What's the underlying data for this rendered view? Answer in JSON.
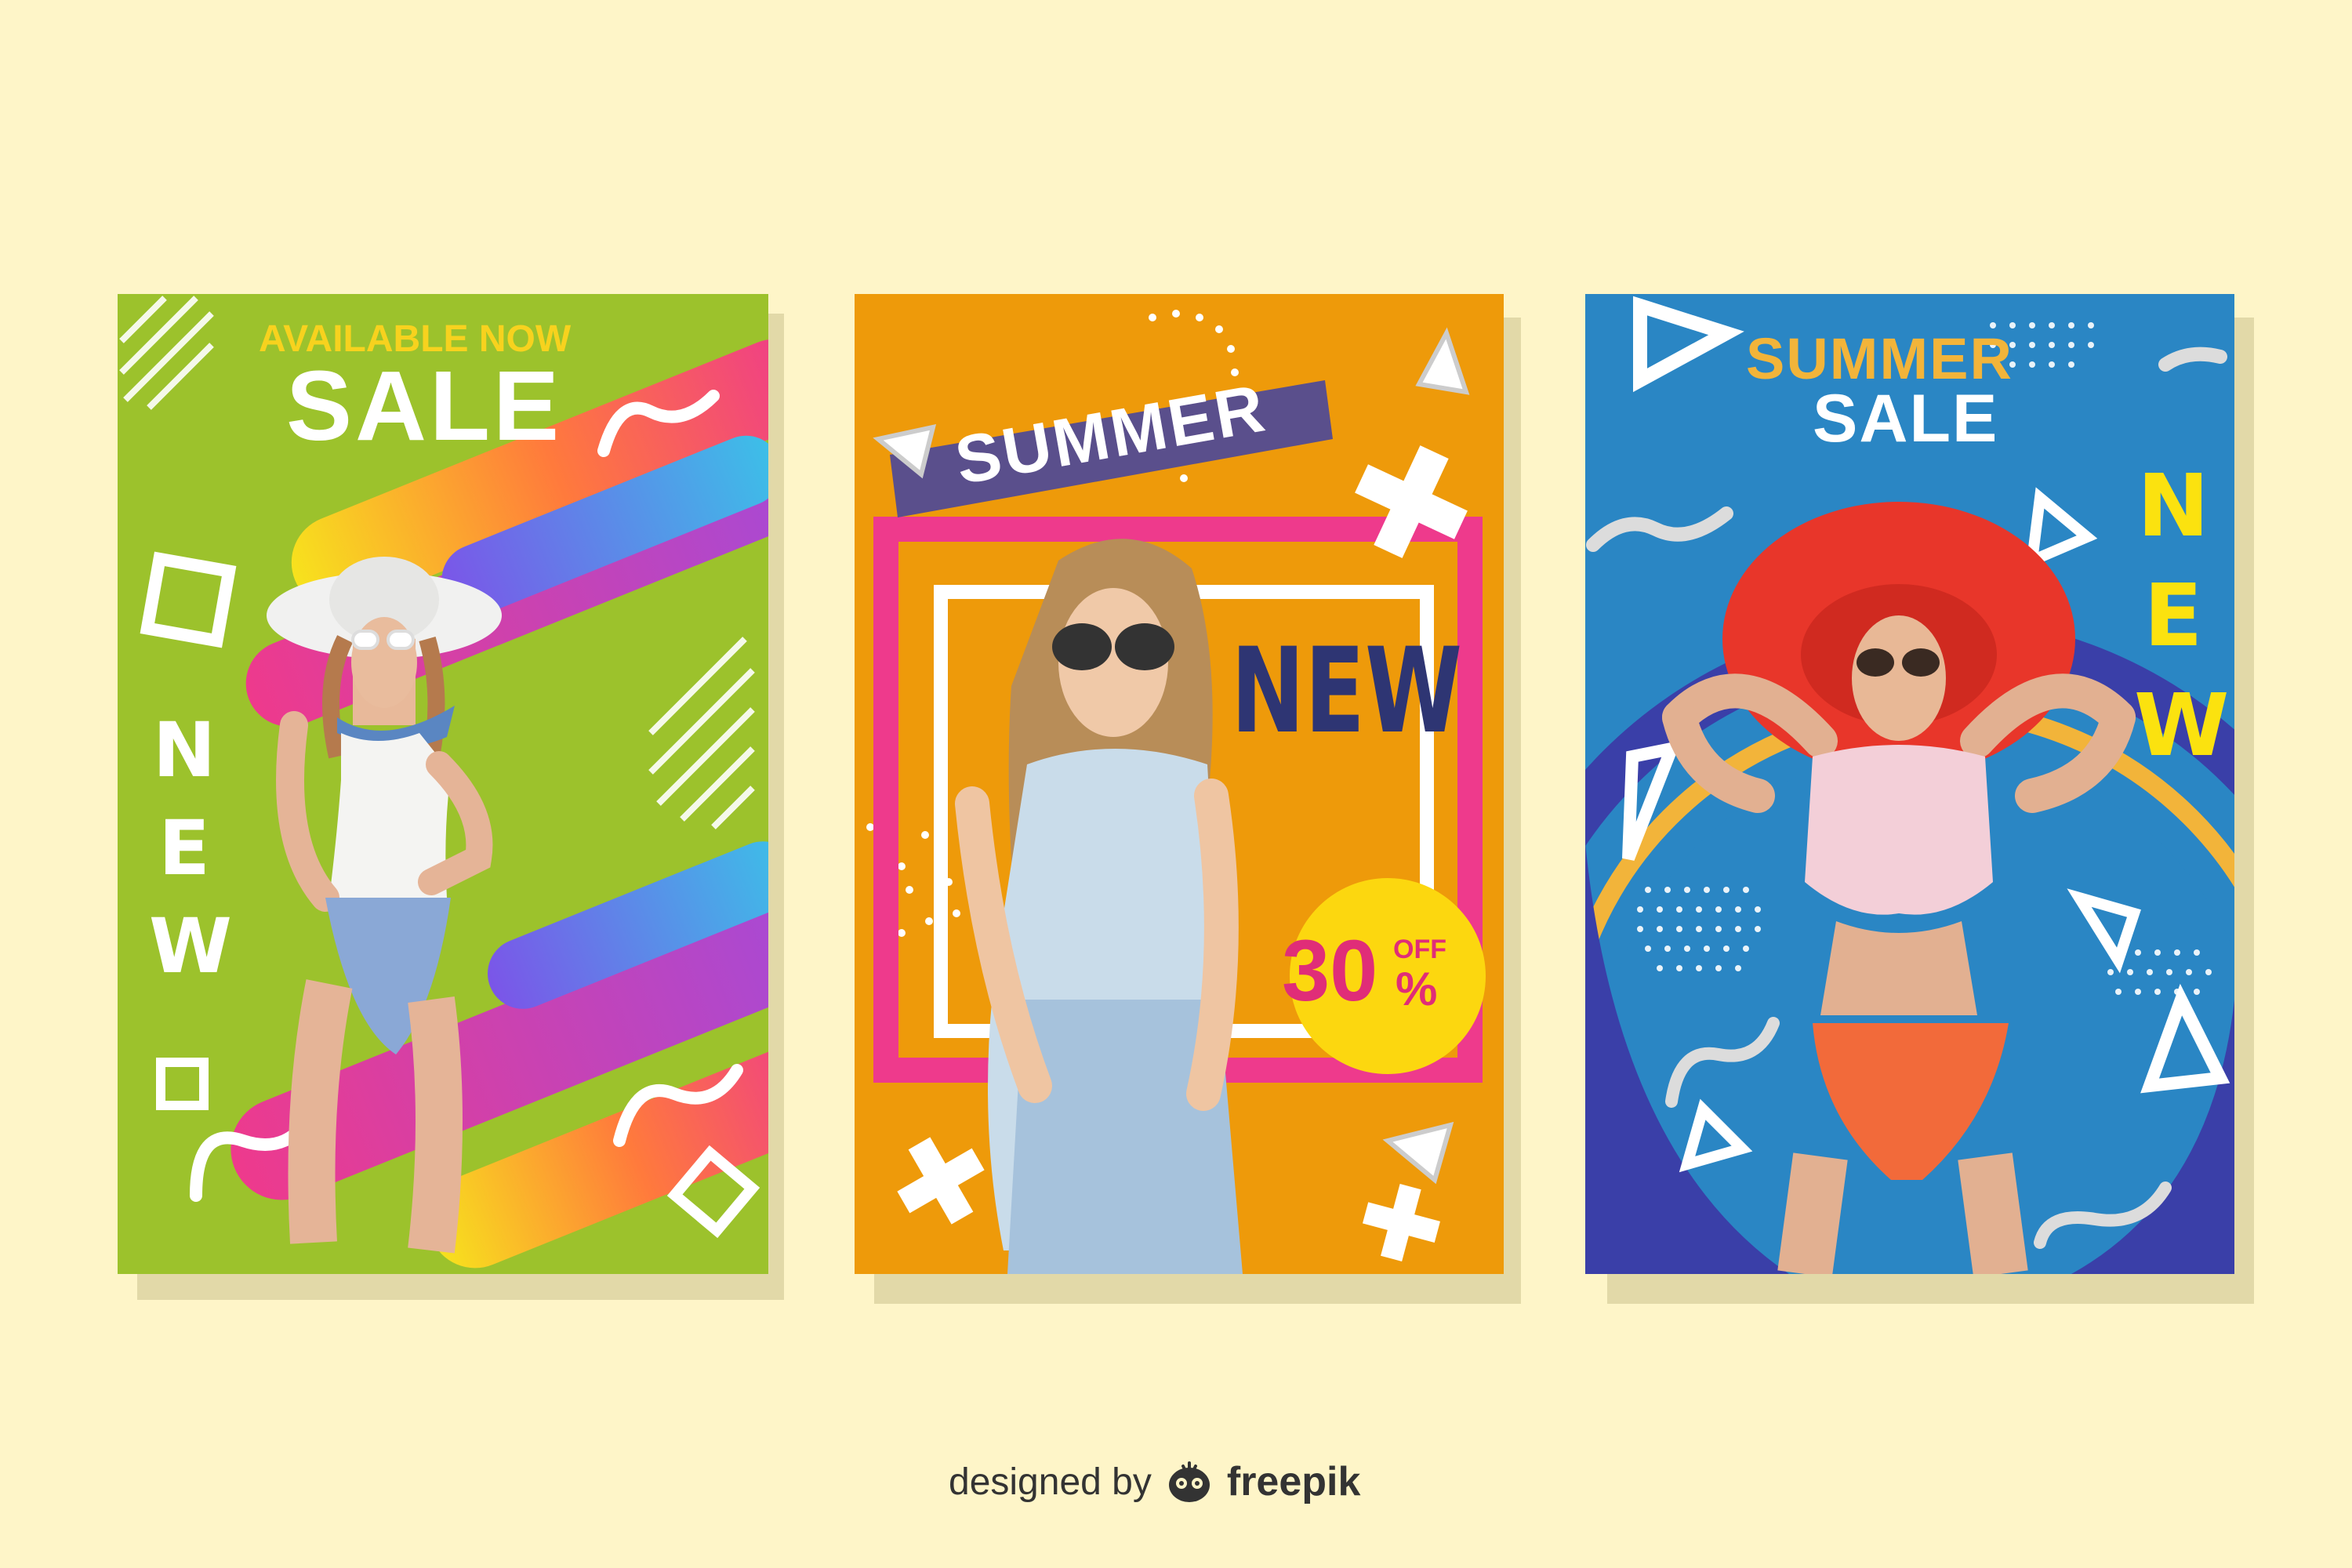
{
  "colors": {
    "background": "#fef5c8",
    "poster1_bg": "#9cc22c",
    "poster2_bg": "#ee9a0a",
    "poster3_bg": "#2a86c4",
    "yellow_text": "#f7d21e",
    "navy": "#2e3573",
    "pink": "#ee3a8c",
    "red_badge_text": "#e02d78"
  },
  "posters": [
    {
      "headline_top": "AVAILABLE NOW",
      "headline_main": "SALE",
      "vertical_word": [
        "N",
        "E",
        "W"
      ],
      "model": "woman-in-white-hat-and-swimsuit"
    },
    {
      "banner": "SUMMER",
      "headline_side": "NEW",
      "badge_value": "30",
      "badge_top": "OFF",
      "badge_bottom": "%",
      "model": "woman-in-sunglasses-and-denim"
    },
    {
      "headline_top": "SUMMER",
      "headline_main": "SALE",
      "vertical_word": [
        "N",
        "E",
        "W"
      ],
      "model": "woman-in-red-hat-and-swimsuit"
    }
  ],
  "credit": {
    "prefix": "designed by",
    "brand": "freepik"
  }
}
